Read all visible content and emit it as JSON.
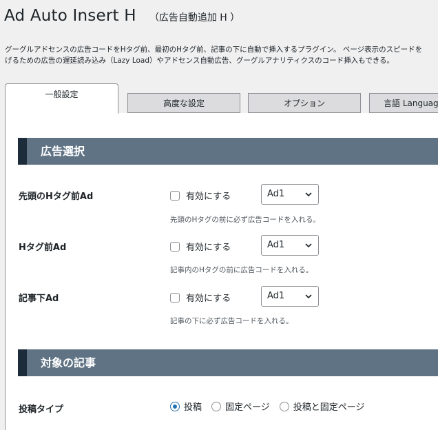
{
  "page": {
    "title": "Ad Auto Insert H",
    "subtitle": "（広告自動追加 H ）",
    "description_line1": "グーグルアドセンスの広告コードをHタグ前、最初のHタグ前、記事の下に自動で挿入するプラグイン。 ページ表示のスピードを",
    "description_line2": "げるための広告の遅延読み込み（Lazy Load）やアドセンス自動広告、グーグルアナリティクスのコード挿入もできる。"
  },
  "tabs": [
    {
      "label": "一般設定",
      "active": true
    },
    {
      "label": "高度な設定",
      "active": false
    },
    {
      "label": "オプション",
      "active": false
    },
    {
      "label": "言語 Language",
      "active": false
    }
  ],
  "sections": {
    "ad_select": {
      "title": "広告選択"
    },
    "target": {
      "title": "対象の記事"
    }
  },
  "ad_rows": [
    {
      "label": "先頭のHタグ前Ad",
      "checkbox_label": "有効にする",
      "checked": false,
      "select_value": "Ad1",
      "help": "先頭のHタグの前に必ず広告コードを入れる。"
    },
    {
      "label": "Hタグ前Ad",
      "checkbox_label": "有効にする",
      "checked": false,
      "select_value": "Ad1",
      "help": "記事内のHタグの前に広告コードを入れる。"
    },
    {
      "label": "記事下Ad",
      "checkbox_label": "有効にする",
      "checked": false,
      "select_value": "Ad1",
      "help": "記事の下に必ず広告コードを入れる。"
    }
  ],
  "post_type": {
    "label": "投稿タイプ",
    "options": [
      {
        "label": "投稿",
        "selected": true
      },
      {
        "label": "固定ページ",
        "selected": false
      },
      {
        "label": "投稿と固定ページ",
        "selected": false
      }
    ]
  },
  "colors": {
    "section_bg": "#5f7384",
    "section_accent": "#1d2c3b",
    "radio_selected": "#2271b1"
  },
  "icons": {
    "select_arrow": "chevron-down-icon"
  }
}
